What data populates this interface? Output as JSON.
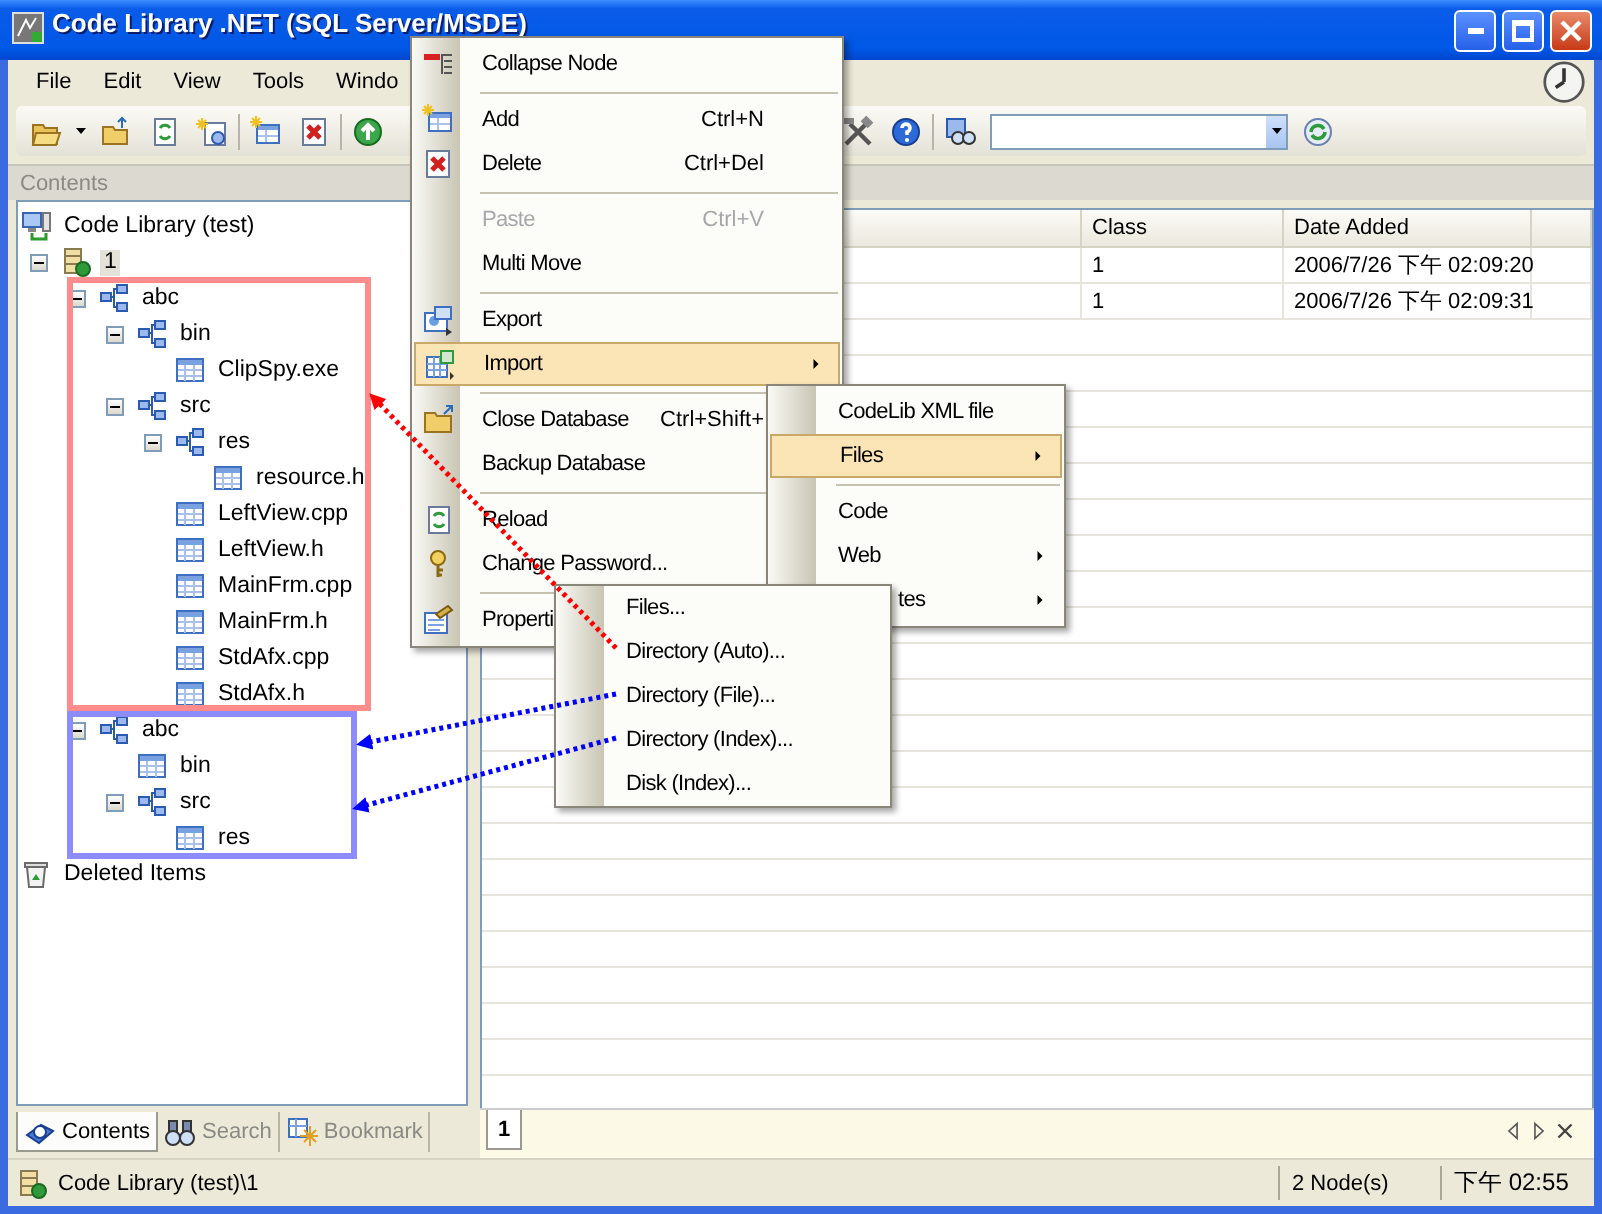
{
  "window": {
    "title": "Code Library .NET (SQL Server/MSDE)"
  },
  "menu_bar": [
    {
      "label": "File"
    },
    {
      "label": "Edit"
    },
    {
      "label": "View"
    },
    {
      "label": "Tools"
    },
    {
      "label": "Windo"
    }
  ],
  "panel_caption": "Contents",
  "tree": {
    "items": [
      {
        "label": "Code Library (test)",
        "kind": "root",
        "selected": false,
        "children": [
          {
            "label": "1",
            "kind": "database",
            "expanded": true,
            "selected": true,
            "children": [
              {
                "label": "abc",
                "kind": "group",
                "expanded": true,
                "selected": false,
                "children": [
                  {
                    "label": "bin",
                    "kind": "group",
                    "expanded": true,
                    "selected": false,
                    "children": [
                      {
                        "label": "ClipSpy.exe",
                        "kind": "file",
                        "selected": false
                      }
                    ]
                  },
                  {
                    "label": "src",
                    "kind": "group",
                    "expanded": true,
                    "selected": false,
                    "children": [
                      {
                        "label": "res",
                        "kind": "group",
                        "expanded": true,
                        "selected": false,
                        "children": [
                          {
                            "label": "resource.h",
                            "kind": "file",
                            "selected": false
                          }
                        ]
                      },
                      {
                        "label": "LeftView.cpp",
                        "kind": "file",
                        "selected": false
                      },
                      {
                        "label": "LeftView.h",
                        "kind": "file",
                        "selected": false
                      },
                      {
                        "label": "MainFrm.cpp",
                        "kind": "file",
                        "selected": false
                      },
                      {
                        "label": "MainFrm.h",
                        "kind": "file",
                        "selected": false
                      },
                      {
                        "label": "StdAfx.cpp",
                        "kind": "file",
                        "selected": false
                      },
                      {
                        "label": "StdAfx.h",
                        "kind": "file",
                        "selected": false
                      }
                    ]
                  }
                ]
              },
              {
                "label": "abc",
                "kind": "group",
                "expanded": true,
                "selected": false,
                "children": [
                  {
                    "label": "bin",
                    "kind": "file",
                    "selected": false
                  },
                  {
                    "label": "src",
                    "kind": "group",
                    "expanded": true,
                    "selected": false,
                    "children": [
                      {
                        "label": "res",
                        "kind": "file",
                        "selected": false
                      }
                    ]
                  }
                ]
              }
            ]
          }
        ]
      },
      {
        "label": "Deleted Items",
        "kind": "trash",
        "selected": false
      }
    ]
  },
  "table": {
    "columns": [
      "Class",
      "Date Added"
    ],
    "rows": [
      {
        "class": "1",
        "date_added": "2006/7/26 下午 02:09:20"
      },
      {
        "class": "1",
        "date_added": "2006/7/26 下午 02:09:31"
      }
    ]
  },
  "left_tabs": [
    {
      "label": "Contents",
      "selected": true
    },
    {
      "label": "Search",
      "selected": false
    },
    {
      "label": "Bookmark",
      "selected": false
    }
  ],
  "document_tabs": [
    {
      "label": "1",
      "selected": true
    }
  ],
  "status_bar": {
    "path": "Code Library (test)\\1",
    "node_count": "2 Node(s)",
    "time": "下午 02:55"
  },
  "context_menu": [
    {
      "kind": "item",
      "label": "Collapse Node",
      "selected": false,
      "disabled": false
    },
    {
      "kind": "separator"
    },
    {
      "kind": "item",
      "label": "Add",
      "shortcut": "Ctrl+N",
      "selected": false,
      "disabled": false
    },
    {
      "kind": "item",
      "label": "Delete",
      "shortcut": "Ctrl+Del",
      "selected": false,
      "disabled": false
    },
    {
      "kind": "separator"
    },
    {
      "kind": "item",
      "label": "Paste",
      "shortcut": "Ctrl+V",
      "selected": false,
      "disabled": true
    },
    {
      "kind": "item",
      "label": "Multi Move",
      "selected": false,
      "disabled": false
    },
    {
      "kind": "separator"
    },
    {
      "kind": "item",
      "label": "Export",
      "selected": false,
      "disabled": false
    },
    {
      "kind": "submenu",
      "label": "Import",
      "selected": true,
      "disabled": false
    },
    {
      "kind": "separator"
    },
    {
      "kind": "item",
      "label": "Close Database",
      "shortcut": "Ctrl+Shift+",
      "selected": false,
      "disabled": false
    },
    {
      "kind": "item",
      "label": "Backup Database",
      "selected": false,
      "disabled": false
    },
    {
      "kind": "separator"
    },
    {
      "kind": "item",
      "label": "Reload",
      "selected": false,
      "disabled": false
    },
    {
      "kind": "item",
      "label": "Change Password...",
      "selected": false,
      "disabled": false
    },
    {
      "kind": "separator"
    },
    {
      "kind": "item",
      "label": "Properti",
      "selected": false,
      "disabled": false
    }
  ],
  "import_menu": [
    {
      "kind": "item",
      "label": "CodeLib XML file",
      "selected": false
    },
    {
      "kind": "submenu",
      "label": "Files",
      "selected": true
    },
    {
      "kind": "separator"
    },
    {
      "kind": "item",
      "label": "Code",
      "selected": false
    },
    {
      "kind": "submenu",
      "label": "Web",
      "selected": false
    },
    {
      "kind": "cut_submenu",
      "label": "tes",
      "selected": false
    }
  ],
  "files_menu": [
    {
      "kind": "item",
      "label": "Files...",
      "selected": false
    },
    {
      "kind": "item",
      "label": "Directory (Auto)...",
      "selected": false
    },
    {
      "kind": "item",
      "label": "Directory (File)...",
      "selected": false
    },
    {
      "kind": "item",
      "label": "Directory (Index)...",
      "selected": false
    },
    {
      "kind": "item",
      "label": "Disk (Index)...",
      "selected": false
    }
  ],
  "annotations": {
    "boxes": [
      {
        "color": "#ff8c8c"
      },
      {
        "color": "#8c8cff"
      }
    ],
    "arrows": [
      {
        "color": "#ff0000"
      },
      {
        "color": "#0000ff"
      },
      {
        "color": "#0000ff"
      }
    ]
  }
}
